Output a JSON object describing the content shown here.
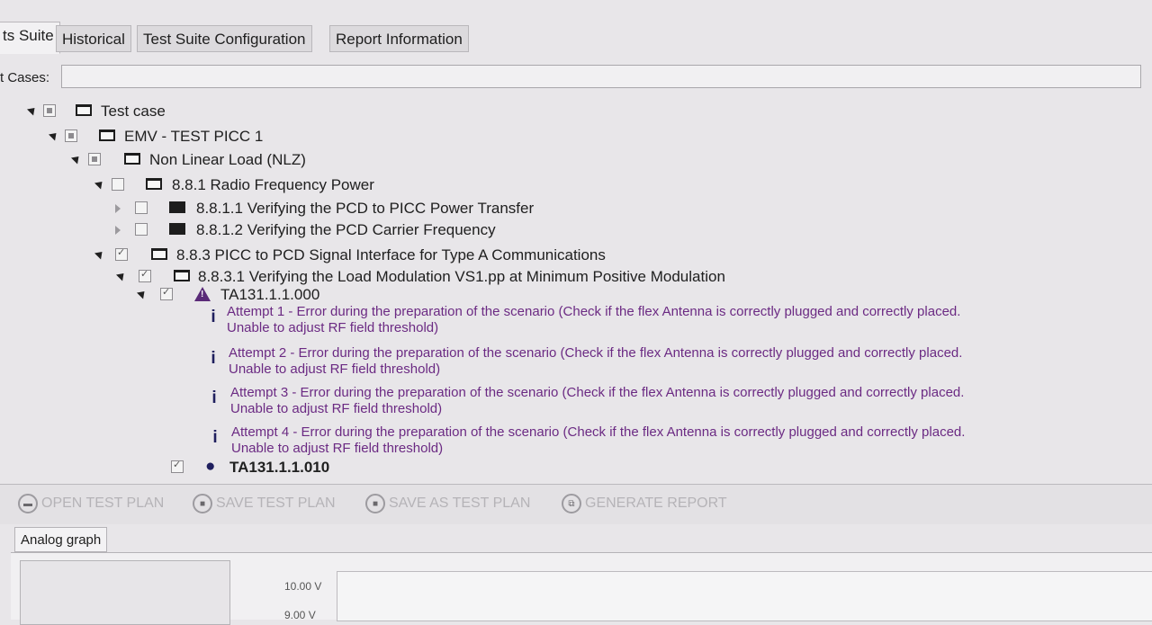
{
  "tabs": [
    "ts Suite",
    "Historical",
    "Test Suite Configuration",
    "Report Information"
  ],
  "cases_label": "t Cases:",
  "tree": [
    {
      "label": "Test case"
    },
    {
      "label": "EMV - TEST PICC 1"
    },
    {
      "label": "Non Linear Load (NLZ)"
    },
    {
      "label": "8.8.1 Radio Frequency Power"
    },
    {
      "label": "8.8.1.1 Verifying the PCD to PICC Power Transfer"
    },
    {
      "label": "8.8.1.2 Verifying the PCD Carrier Frequency"
    },
    {
      "label": "8.8.3 PICC to PCD Signal Interface for Type A Communications"
    },
    {
      "label": "8.8.3.1 Verifying the Load Modulation VS1.pp at Minimum Positive Modulation"
    },
    {
      "label": "TA131.1.1.000"
    },
    {
      "label": "TA131.1.1.010"
    }
  ],
  "messages": [
    {
      "line1": "Attempt 1 - Error during the preparation of the scenario (Check if the flex Antenna is correctly plugged and correctly placed.",
      "line2": "Unable to adjust RF field threshold)"
    },
    {
      "line1": "Attempt 2 - Error during the preparation of the scenario (Check if the flex Antenna is correctly plugged and correctly placed.",
      "line2": "Unable to adjust RF field threshold)"
    },
    {
      "line1": "Attempt 3 - Error during the preparation of the scenario (Check if the flex Antenna is correctly plugged and correctly placed.",
      "line2": "Unable to adjust RF field threshold)"
    },
    {
      "line1": "Attempt 4 - Error during the preparation of the scenario (Check if the flex Antenna is correctly plugged and correctly placed.",
      "line2": "Unable to adjust RF field threshold)"
    }
  ],
  "toolbar": {
    "open": "OPEN TEST PLAN",
    "save": "SAVE TEST PLAN",
    "save_as": "SAVE AS TEST PLAN",
    "generate": "GENERATE REPORT"
  },
  "graph_tab": "Analog graph",
  "graph": {
    "y_labels": [
      "10.00 V",
      "9.00 V"
    ]
  },
  "colors": {
    "message": "#6b2a83",
    "warning": "#5a2a78"
  }
}
